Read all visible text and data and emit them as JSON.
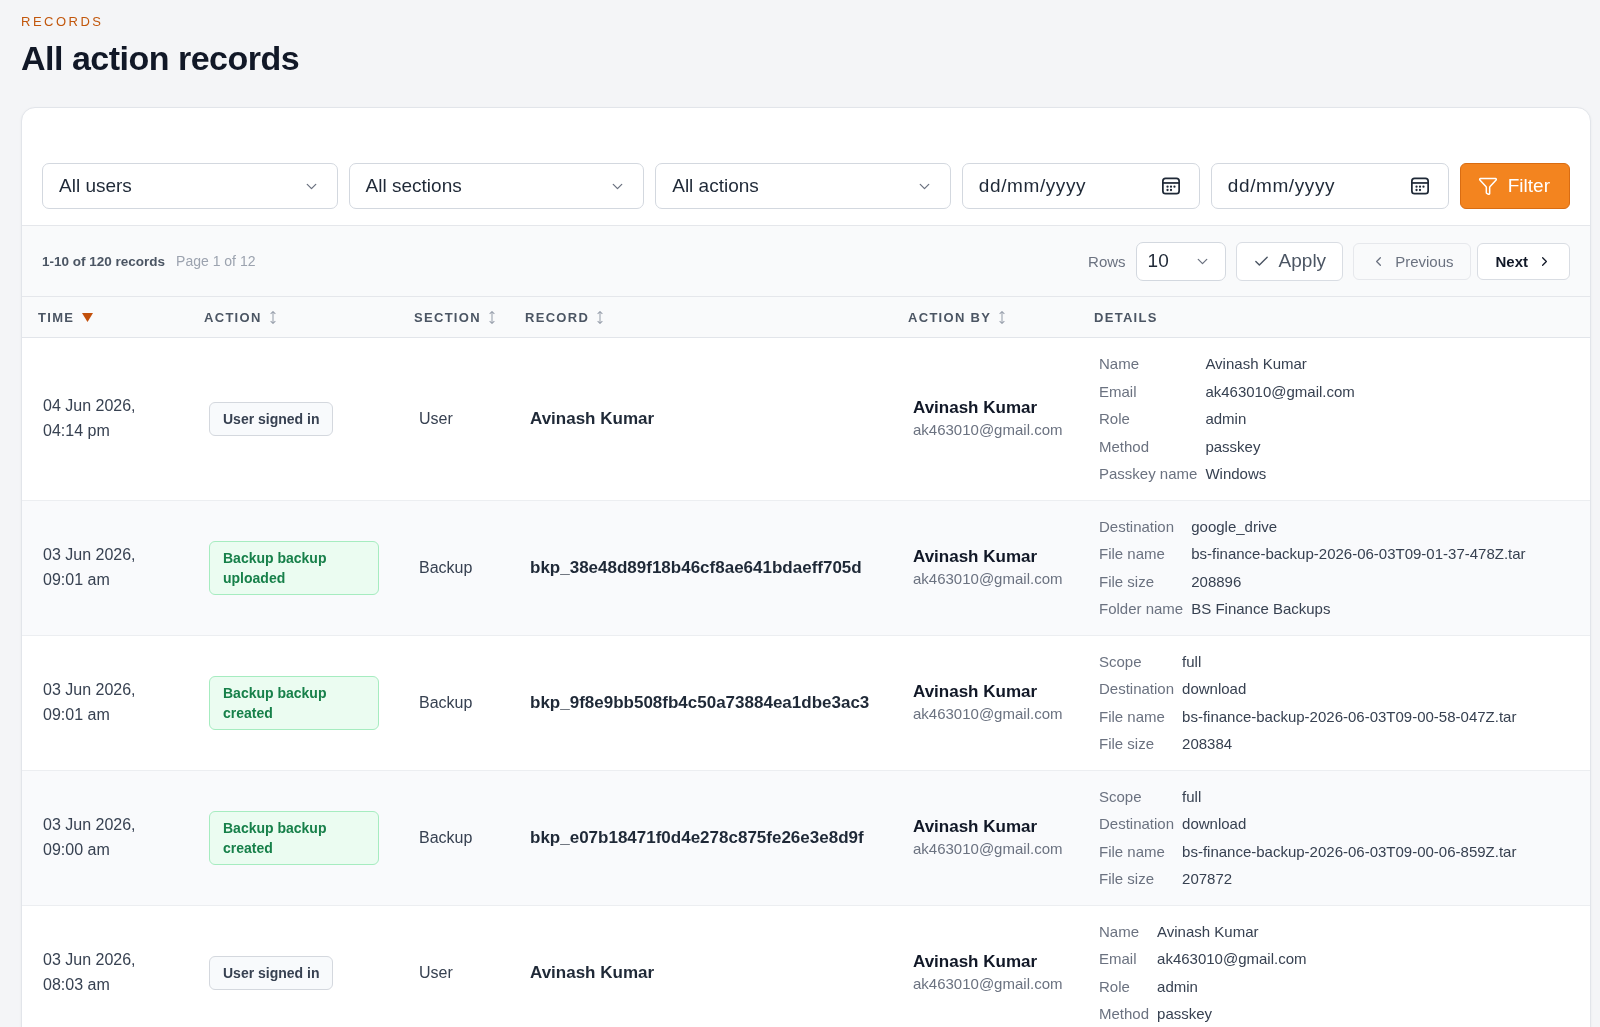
{
  "header": {
    "eyebrow": "RECORDS",
    "title": "All action records"
  },
  "filters": {
    "dropdowns": [
      {
        "value": "All users"
      },
      {
        "value": "All sections"
      },
      {
        "value": "All actions"
      }
    ],
    "date_fields": [
      {
        "placeholder": "dd/mm/yyyy"
      },
      {
        "placeholder": "dd/mm/yyyy"
      }
    ],
    "filter_button": "Filter"
  },
  "toolbar": {
    "summary": "1-10 of 120 records",
    "page": "Page 1 of 12",
    "rows": {
      "label": "Rows",
      "value": "10"
    },
    "apply_button": "Apply",
    "pager": [
      {
        "label": "Previous",
        "kind": "previous",
        "disabled": true
      },
      {
        "label": "Next",
        "kind": "next",
        "disabled": false
      }
    ]
  },
  "table": {
    "columns": [
      {
        "label": "TIME",
        "kind": "sorted"
      },
      {
        "label": "ACTION",
        "kind": "sortable"
      },
      {
        "label": "SECTION",
        "kind": "sortable"
      },
      {
        "label": "RECORD",
        "kind": "sortable"
      },
      {
        "label": "ACTION BY",
        "kind": "sortable"
      },
      {
        "label": "DETAILS",
        "kind": "plain"
      }
    ],
    "rows": [
      {
        "time": "04 Jun 2026, 04:14 pm",
        "action": {
          "label": "User signed in",
          "kind": "neutral"
        },
        "section": "User",
        "record": "Avinash Kumar",
        "action_by": {
          "name": "Avinash Kumar",
          "email": "ak463010@gmail.com"
        },
        "details": [
          {
            "label": "Name",
            "value": "Avinash Kumar"
          },
          {
            "label": "Email",
            "value": "ak463010@gmail.com"
          },
          {
            "label": "Role",
            "value": "admin"
          },
          {
            "label": "Method",
            "value": "passkey"
          },
          {
            "label": "Passkey name",
            "value": "Windows"
          }
        ]
      },
      {
        "time": "03 Jun 2026, 09:01 am",
        "action": {
          "label": "Backup backup uploaded",
          "kind": "success"
        },
        "section": "Backup",
        "record": "bkp_38e48d89f18b46cf8ae641bdaeff705d",
        "action_by": {
          "name": "Avinash Kumar",
          "email": "ak463010@gmail.com"
        },
        "details": [
          {
            "label": "Destination",
            "value": "google_drive"
          },
          {
            "label": "File name",
            "value": "bs-finance-backup-2026-06-03T09-01-37-478Z.tar"
          },
          {
            "label": "File size",
            "value": "208896"
          },
          {
            "label": "Folder name",
            "value": "BS Finance Backups"
          }
        ]
      },
      {
        "time": "03 Jun 2026, 09:01 am",
        "action": {
          "label": "Backup backup created",
          "kind": "success"
        },
        "section": "Backup",
        "record": "bkp_9f8e9bb508fb4c50a73884ea1dbe3ac3",
        "action_by": {
          "name": "Avinash Kumar",
          "email": "ak463010@gmail.com"
        },
        "details": [
          {
            "label": "Scope",
            "value": "full"
          },
          {
            "label": "Destination",
            "value": "download"
          },
          {
            "label": "File name",
            "value": "bs-finance-backup-2026-06-03T09-00-58-047Z.tar"
          },
          {
            "label": "File size",
            "value": "208384"
          }
        ]
      },
      {
        "time": "03 Jun 2026, 09:00 am",
        "action": {
          "label": "Backup backup created",
          "kind": "success"
        },
        "section": "Backup",
        "record": "bkp_e07b18471f0d4e278c875fe26e3e8d9f",
        "action_by": {
          "name": "Avinash Kumar",
          "email": "ak463010@gmail.com"
        },
        "details": [
          {
            "label": "Scope",
            "value": "full"
          },
          {
            "label": "Destination",
            "value": "download"
          },
          {
            "label": "File name",
            "value": "bs-finance-backup-2026-06-03T09-00-06-859Z.tar"
          },
          {
            "label": "File size",
            "value": "207872"
          }
        ]
      },
      {
        "time": "03 Jun 2026, 08:03 am",
        "action": {
          "label": "User signed in",
          "kind": "neutral"
        },
        "section": "User",
        "record": "Avinash Kumar",
        "action_by": {
          "name": "Avinash Kumar",
          "email": "ak463010@gmail.com"
        },
        "details": [
          {
            "label": "Name",
            "value": "Avinash Kumar"
          },
          {
            "label": "Email",
            "value": "ak463010@gmail.com"
          },
          {
            "label": "Role",
            "value": "admin"
          },
          {
            "label": "Method",
            "value": "passkey"
          }
        ]
      }
    ]
  }
}
